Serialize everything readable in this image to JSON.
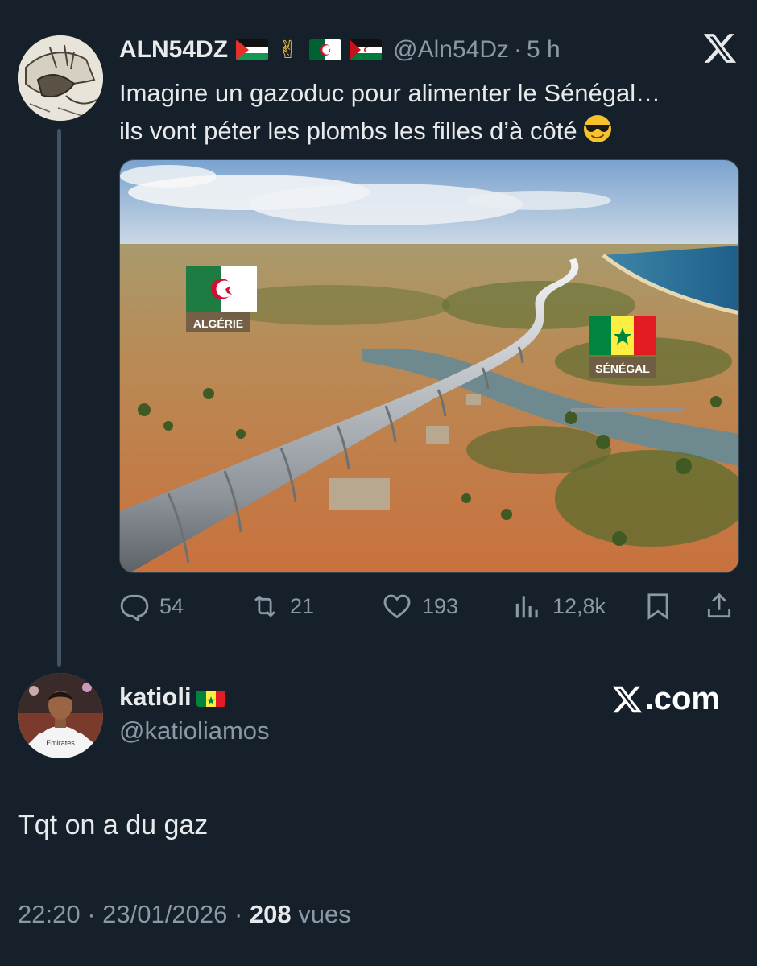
{
  "quoted_tweet": {
    "author_name": "ALN54DZ",
    "handle": "@Aln54Dz",
    "separator": "·",
    "time": "5 h",
    "text_line1": "Imagine un gazoduc pour alimenter le Sénégal…",
    "text_line2": "ils vont péter les plombs les filles d’à côté",
    "image_labels": {
      "left_flag": "ALGÉRIE",
      "right_flag": "SÉNÉGAL"
    },
    "stats": {
      "replies": "54",
      "retweets": "21",
      "likes": "193",
      "views": "12,8k"
    }
  },
  "reply": {
    "author_name": "katioli",
    "handle": "@katioliamos",
    "brand": ".com",
    "text": "Tqt on a du gaz",
    "time": "22:20",
    "separator": "·",
    "date": "23/01/2026",
    "views_count": "208",
    "views_label": "vues"
  },
  "icons": [
    "x-logo-icon",
    "reply-icon",
    "retweet-icon",
    "like-icon",
    "views-icon",
    "bookmark-icon",
    "share-icon"
  ],
  "colors": {
    "background": "#15202b",
    "text": "#e7e9ea",
    "muted": "#8b98a5"
  }
}
